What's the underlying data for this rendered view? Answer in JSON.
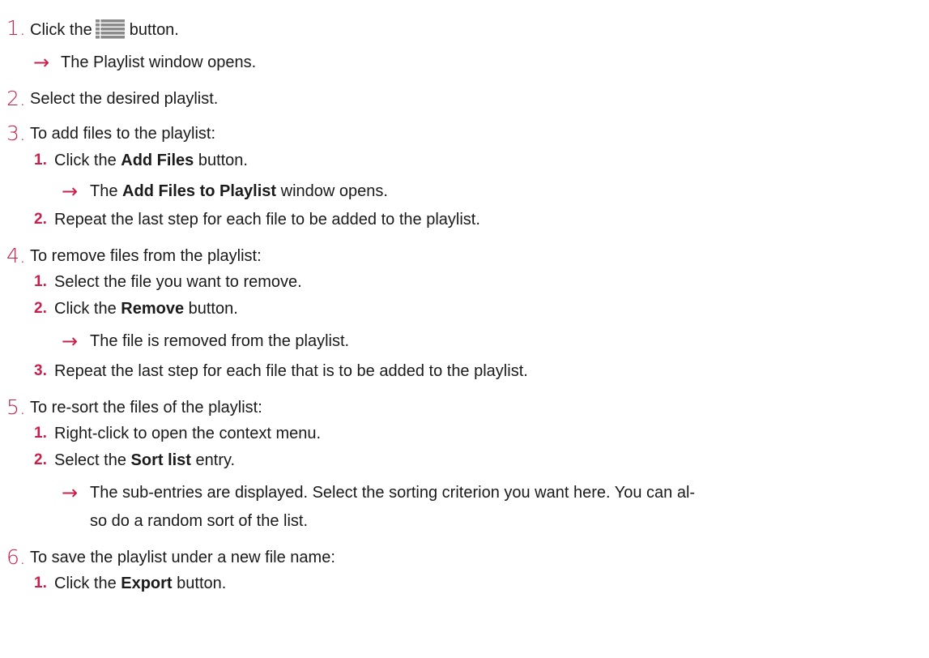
{
  "steps": [
    {
      "num": "1.",
      "text_before": "Click the",
      "icon": "list-menu-icon",
      "text_after": "button.",
      "result": "The Playlist window opens."
    },
    {
      "num": "2.",
      "text": "Select the desired playlist."
    },
    {
      "num": "3.",
      "text": "To add files to the playlist:",
      "substeps": [
        {
          "num": "1.",
          "before": "Click the ",
          "bold": "Add Files",
          "after": " button.",
          "result": {
            "before": "The ",
            "bold": "Add Files to Playlist",
            "after": " window opens."
          }
        },
        {
          "num": "2.",
          "text": "Repeat the last step for each file to be added to the playlist."
        }
      ]
    },
    {
      "num": "4.",
      "text": "To remove files from the playlist:",
      "substeps": [
        {
          "num": "1.",
          "text": "Select the file you want to remove."
        },
        {
          "num": "2.",
          "before": "Click the ",
          "bold": "Remove",
          "after": " button.",
          "result": "The file is removed from the playlist."
        },
        {
          "num": "3.",
          "text": "Repeat the last step for each file that is to be added to the playlist."
        }
      ]
    },
    {
      "num": "5.",
      "text": "To re-sort the files of the playlist:",
      "substeps": [
        {
          "num": "1.",
          "text": "Right-click to open the context menu."
        },
        {
          "num": "2.",
          "before": "Select the ",
          "bold": "Sort list",
          "after": " entry.",
          "result_line1": "The sub-entries are displayed. Select the sorting criterion you want here. You can al-",
          "result_line2": "so do a random sort of the list."
        }
      ]
    },
    {
      "num": "6.",
      "text": "To save the playlist under a new file name:",
      "substeps": [
        {
          "num": "1.",
          "before": "Click the ",
          "bold": "Export",
          "after": " button."
        }
      ]
    }
  ],
  "arrow_glyph": "→",
  "colors": {
    "accent": "#c8204a",
    "text": "#1a1a1a"
  }
}
